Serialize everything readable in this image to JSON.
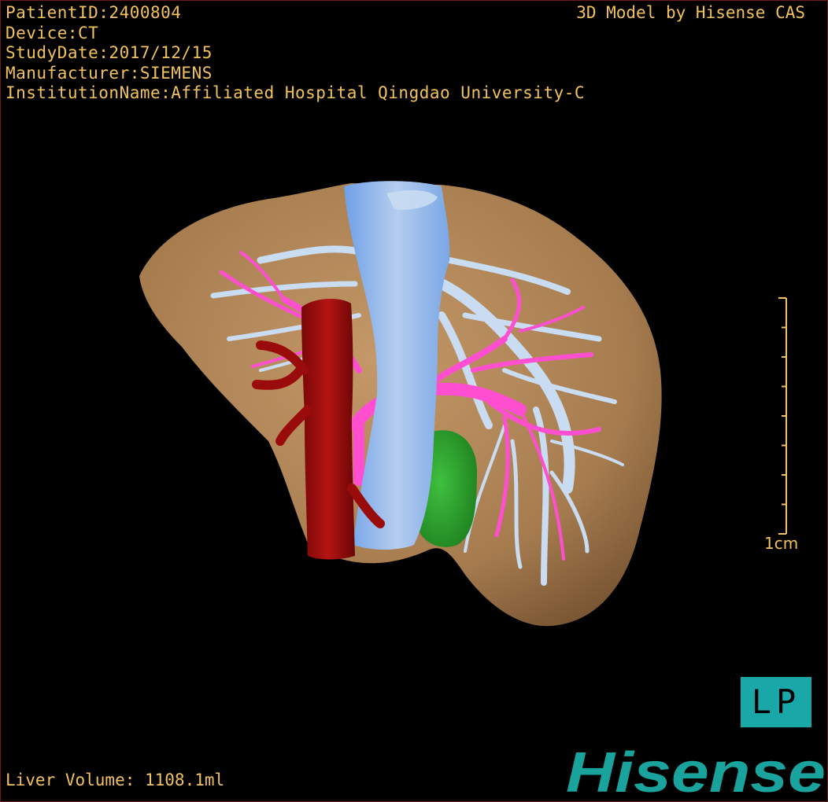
{
  "overlay": {
    "patient_id": "PatientID:2400804",
    "device": "Device:CT",
    "study_date": "StudyDate:2017/12/15",
    "manufacturer": "Manufacturer:SIEMENS",
    "institution": "InstitutionName:Affiliated Hospital Qingdao University-C",
    "model_credit": "3D Model by Hisense CAS"
  },
  "scale": {
    "label": "1cm"
  },
  "orientation": {
    "label": "LP"
  },
  "footer": {
    "liver_volume": "Liver Volume: 1108.1ml"
  },
  "logo": {
    "text": "Hisense",
    "color": "#1aa29c"
  },
  "colors": {
    "overlay_text": "#f2c25b",
    "liver": "#b48a5a",
    "ivc": "#8fb6f0",
    "aorta": "#a50c0c",
    "portal_vein": "#ff4fd0",
    "hepatic_vein": "#c9dcf2",
    "gallbladder": "#2fa82f"
  }
}
